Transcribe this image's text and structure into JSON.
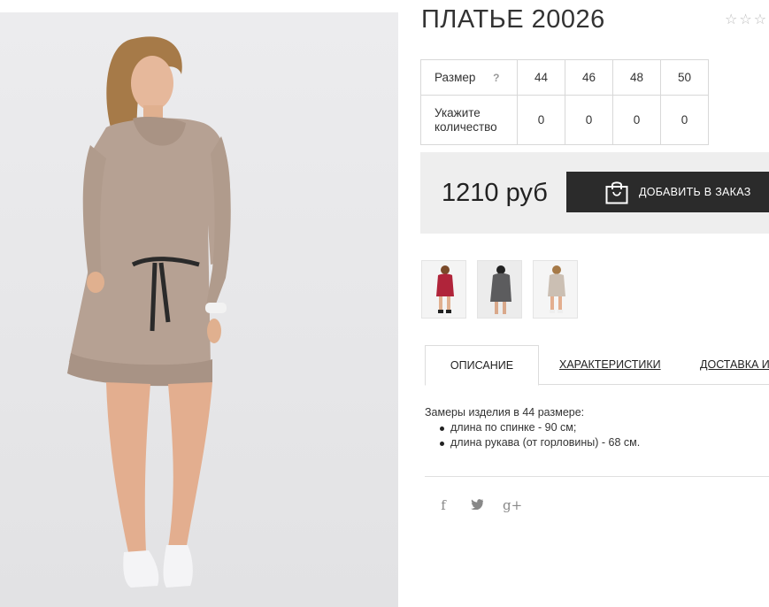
{
  "product": {
    "title": "ПЛАТЬЕ 20026",
    "rating_icon": "star-outline-icon"
  },
  "size_table": {
    "size_label": "Размер",
    "help_label": "?",
    "sizes": [
      "44",
      "46",
      "48",
      "50"
    ],
    "qty_label": "Укажите количество",
    "quantities": [
      "0",
      "0",
      "0",
      "0"
    ]
  },
  "purchase": {
    "price": "1210 руб",
    "add_button_label": "ДОБАВИТЬ В ЗАКАЗ",
    "button_icon": "shopping-bag-icon",
    "button_color": "#2b2b2b"
  },
  "thumbnails": [
    {
      "color": "#b0243a",
      "name": "red"
    },
    {
      "color": "#5c5c5e",
      "name": "grey"
    },
    {
      "color": "#cbbfb3",
      "name": "beige"
    }
  ],
  "tabs": {
    "description": "ОПИСАНИЕ",
    "characteristics": "ХАРАКТЕРИСТИКИ",
    "delivery": "ДОСТАВКА И"
  },
  "description": {
    "intro": "Замеры изделия в 44 размере:",
    "items": [
      "длина по спинке - 90 см;",
      "длина рукава (от горловины) - 68 см."
    ]
  },
  "social": {
    "facebook": "f",
    "twitter": "t",
    "google_plus": "g+"
  }
}
